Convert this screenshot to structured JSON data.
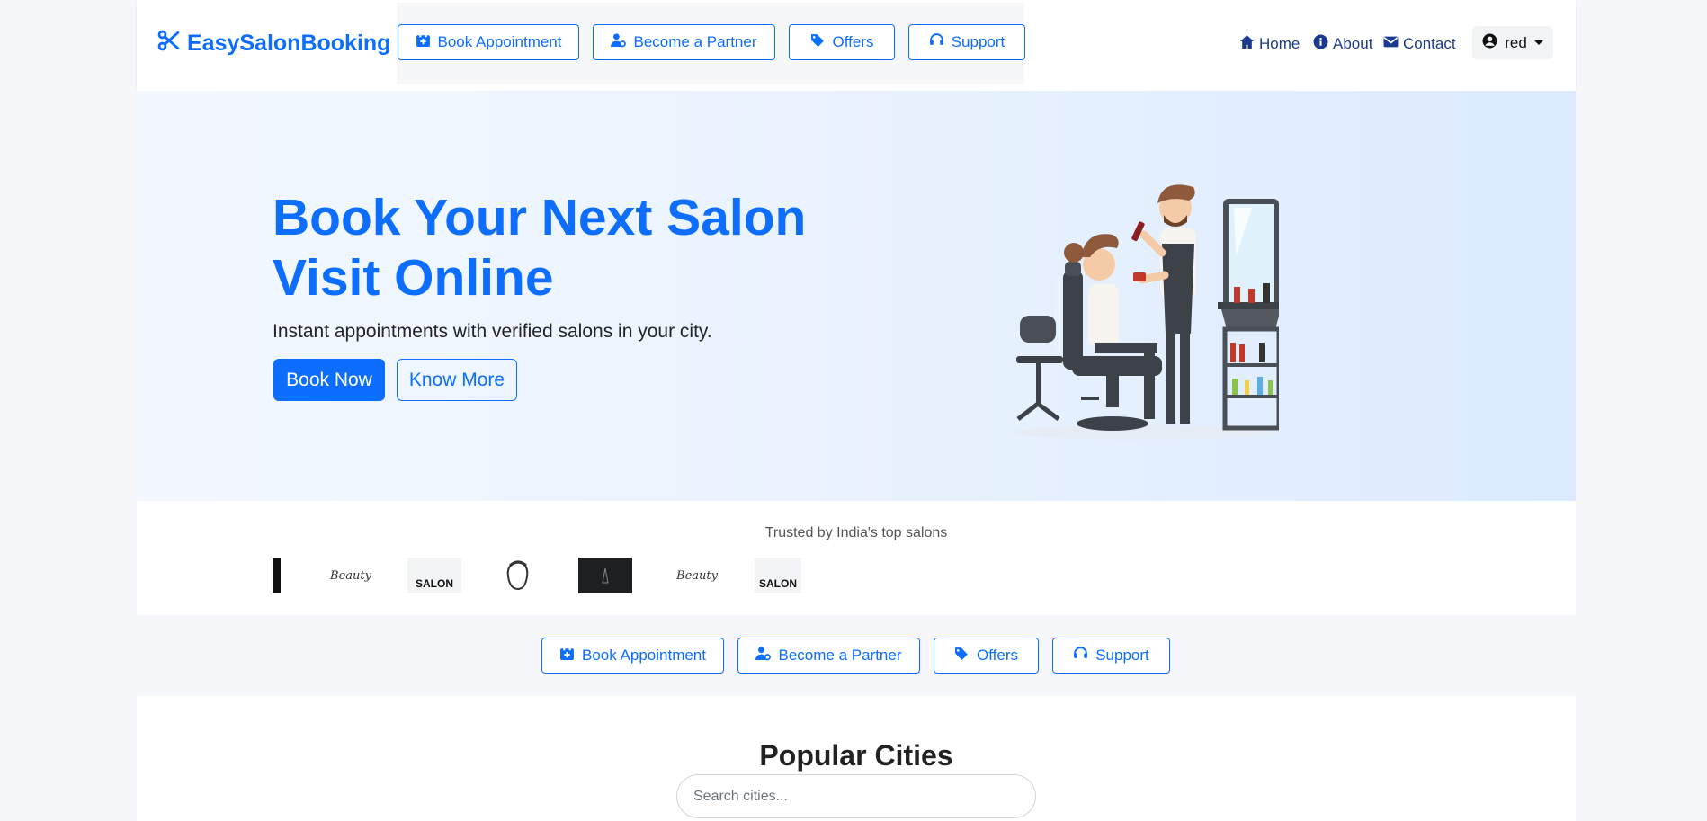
{
  "brand": {
    "name": "EasySalonBooking",
    "icon": "scissors-icon"
  },
  "quick_actions": [
    {
      "label": "Book Appointment",
      "icon": "calendar-plus-icon"
    },
    {
      "label": "Become a Partner",
      "icon": "user-gear-icon"
    },
    {
      "label": "Offers",
      "icon": "tags-icon"
    },
    {
      "label": "Support",
      "icon": "headset-icon"
    }
  ],
  "nav": {
    "home": "Home",
    "about": "About",
    "contact": "Contact",
    "user": "red"
  },
  "hero": {
    "title": "Book Your Next Salon Visit Online",
    "subtitle": "Instant appointments with verified salons in your city.",
    "primary_cta": "Book Now",
    "secondary_cta": "Know More"
  },
  "trust": {
    "text": "Trusted by India's top salons",
    "logos": [
      "Beauty",
      "SALON",
      "Beauty",
      "SALON"
    ]
  },
  "cities": {
    "title": "Popular Cities",
    "search_placeholder": "Search cities..."
  },
  "colors": {
    "accent": "#0d6efd",
    "nav_text": "#1a3a8f"
  }
}
